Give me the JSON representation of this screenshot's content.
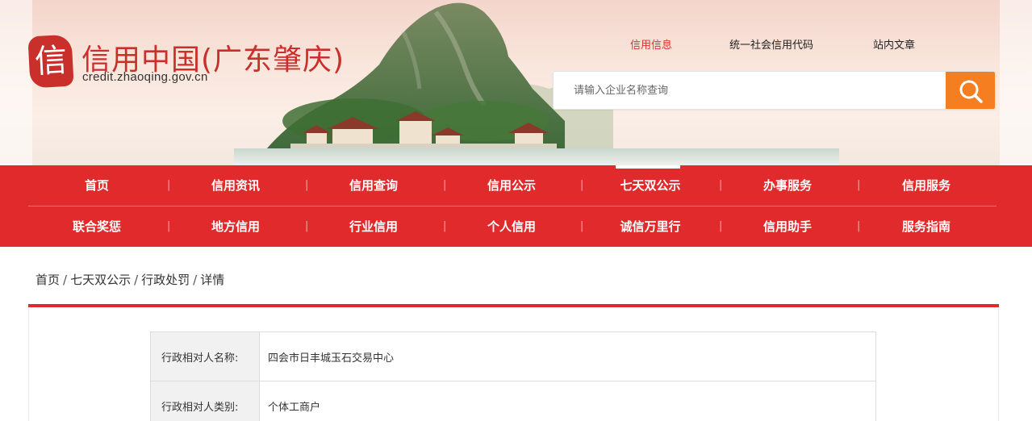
{
  "logo": {
    "seal_char": "信",
    "title": "信用中国(广东肇庆)",
    "url": "credit.zhaoqing.gov.cn"
  },
  "top_links": [
    {
      "label": "信用信息",
      "active": true
    },
    {
      "label": "统一社会信用代码",
      "active": false
    },
    {
      "label": "站内文章",
      "active": false
    }
  ],
  "search": {
    "placeholder": "请输入企业名称查询",
    "value": "",
    "button_icon": "search-icon"
  },
  "nav": {
    "row1": [
      {
        "label": "首页"
      },
      {
        "label": "信用资讯"
      },
      {
        "label": "信用查询"
      },
      {
        "label": "信用公示"
      },
      {
        "label": "七天双公示",
        "active": true
      },
      {
        "label": "办事服务"
      },
      {
        "label": "信用服务"
      }
    ],
    "row2": [
      {
        "label": "联合奖惩"
      },
      {
        "label": "地方信用"
      },
      {
        "label": "行业信用"
      },
      {
        "label": "个人信用"
      },
      {
        "label": "诚信万里行"
      },
      {
        "label": "信用助手"
      },
      {
        "label": "服务指南"
      }
    ],
    "separator": "|"
  },
  "breadcrumb": {
    "items": [
      "首页",
      "七天双公示",
      "行政处罚",
      "详情"
    ],
    "separator": "/"
  },
  "detail": {
    "rows": [
      {
        "label": "行政相对人名称:",
        "value": "四会市日丰城玉石交易中心"
      },
      {
        "label": "行政相对人类别:",
        "value": "个体工商户"
      }
    ]
  },
  "colors": {
    "brand_red": "#e12a2b",
    "search_orange": "#f57f20",
    "logo_red": "#c9302c"
  }
}
